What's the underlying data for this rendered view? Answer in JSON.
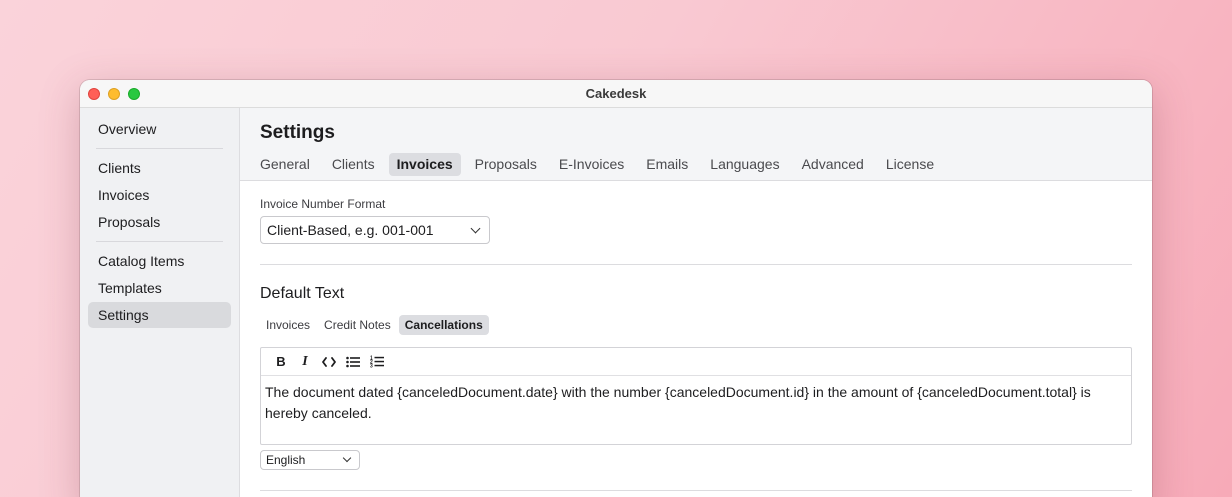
{
  "window": {
    "title": "Cakedesk"
  },
  "sidebar": {
    "groups": [
      [
        {
          "label": "Overview"
        }
      ],
      [
        {
          "label": "Clients"
        },
        {
          "label": "Invoices"
        },
        {
          "label": "Proposals"
        }
      ],
      [
        {
          "label": "Catalog Items"
        },
        {
          "label": "Templates"
        },
        {
          "label": "Settings",
          "active": true
        }
      ]
    ]
  },
  "header": {
    "title": "Settings",
    "tabs": [
      "General",
      "Clients",
      "Invoices",
      "Proposals",
      "E-Invoices",
      "Emails",
      "Languages",
      "Advanced",
      "License"
    ],
    "active_tab": "Invoices"
  },
  "invoice_number": {
    "label": "Invoice Number Format",
    "value": "Client-Based, e.g. 001-001"
  },
  "default_text": {
    "title": "Default Text",
    "subtabs": [
      "Invoices",
      "Credit Notes",
      "Cancellations"
    ],
    "active_subtab": "Cancellations",
    "toolbar": {
      "bold": "B",
      "italic": "I"
    },
    "body": "The document dated {canceledDocument.date} with the number {canceledDocument.id} in the amount of {canceledDocument.total} is hereby canceled.",
    "language": "English"
  }
}
